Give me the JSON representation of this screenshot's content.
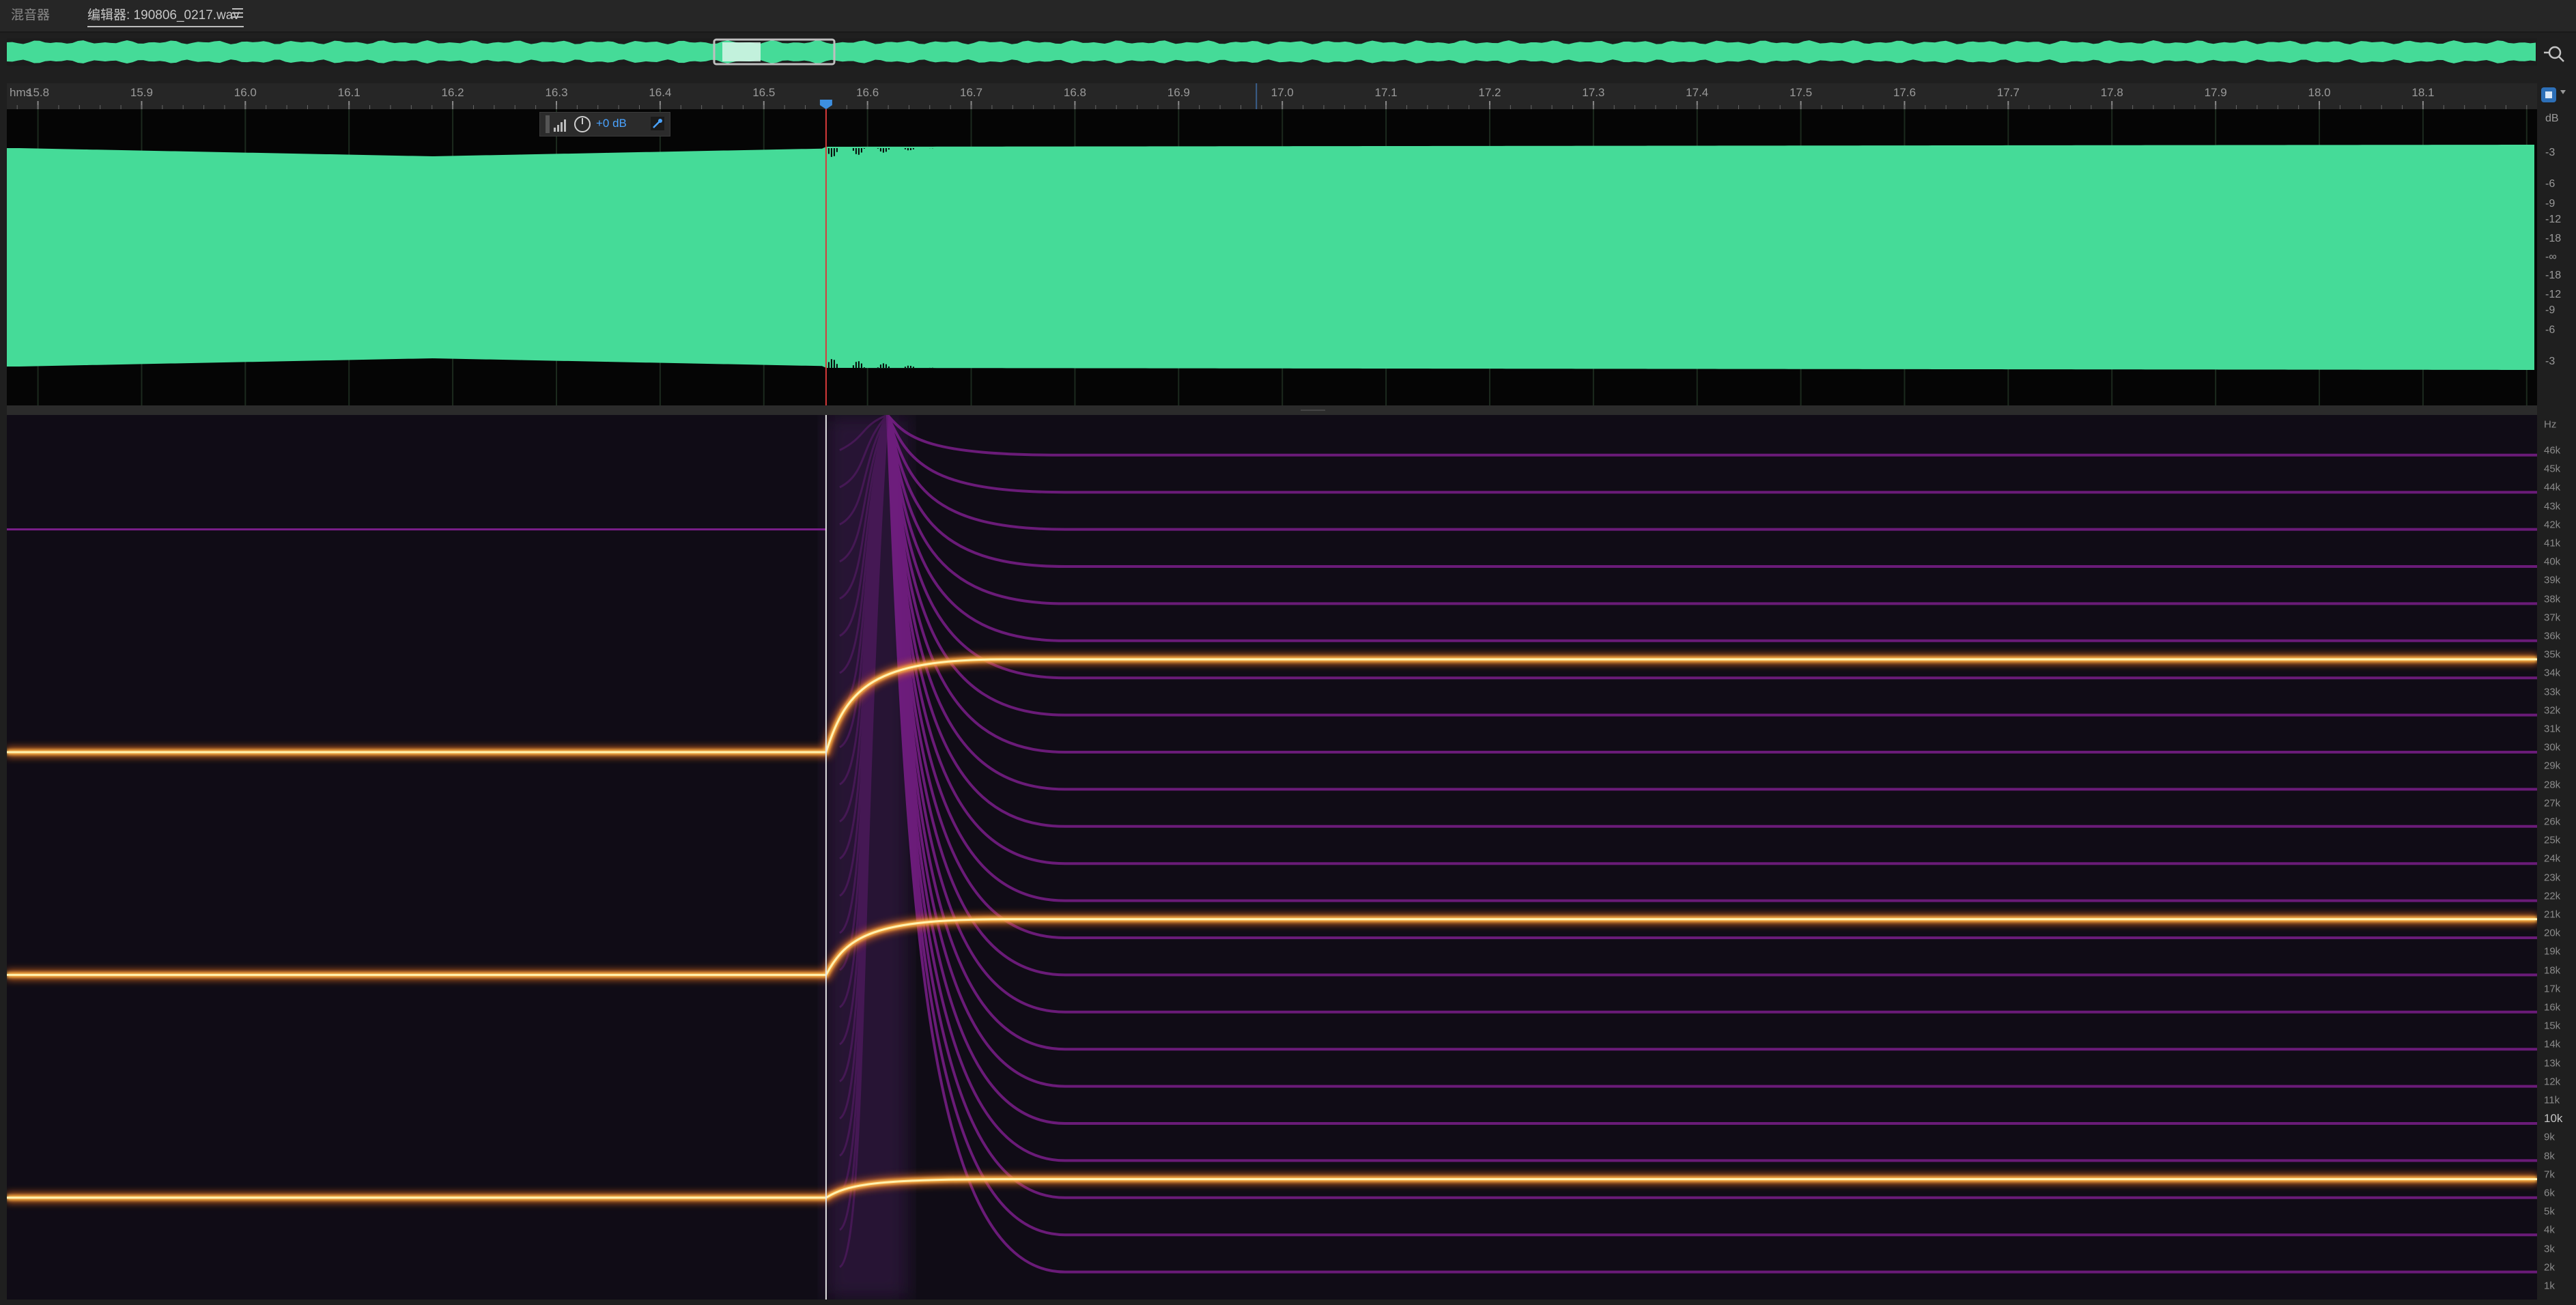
{
  "tabs": {
    "mixer": "混音器",
    "editor": "编辑器: 190806_0217.wav"
  },
  "ruler": {
    "unit": "hms",
    "range": [
      15.77,
      18.21
    ],
    "ticks": [
      "15.8",
      "15.9",
      "16.0",
      "16.1",
      "16.2",
      "16.3",
      "16.4",
      "16.5",
      "16.6",
      "16.7",
      "16.8",
      "16.9",
      "17.0",
      "17.1",
      "17.2",
      "17.3",
      "17.4",
      "17.5",
      "17.6",
      "17.7",
      "17.8",
      "17.9",
      "18.0",
      "18.1"
    ]
  },
  "playhead_time": 16.56,
  "hud": {
    "gain_label": "+0 dB"
  },
  "db_scale": {
    "unit": "dB",
    "labels": [
      "-3",
      "-6",
      "-9",
      "-12",
      "-18",
      "-∞",
      "-18",
      "-12",
      "-9",
      "-6",
      "-3"
    ]
  },
  "hz_scale": {
    "unit": "Hz",
    "labels": [
      "46k",
      "45k",
      "44k",
      "43k",
      "42k",
      "41k",
      "40k",
      "39k",
      "38k",
      "37k",
      "36k",
      "35k",
      "34k",
      "33k",
      "32k",
      "31k",
      "30k",
      "29k",
      "28k",
      "27k",
      "26k",
      "25k",
      "24k",
      "23k",
      "22k",
      "21k",
      "20k",
      "19k",
      "18k",
      "17k",
      "16k",
      "15k",
      "14k",
      "13k",
      "12k",
      "11k",
      "10k",
      "9k",
      "8k",
      "7k",
      "6k",
      "5k",
      "4k",
      "3k",
      "2k",
      "1k"
    ],
    "major": "10k"
  },
  "spectrogram": {
    "tones_before_hz": [
      29750,
      17750,
      5750
    ],
    "tones_after_hz": [
      34750,
      20750,
      6750
    ],
    "faint_line_before_hz": 41750
  },
  "colors": {
    "waveform": "#45db98",
    "background": "#1f1f1f",
    "playhead": "#d83a3a",
    "accent": "#4aa3ff"
  },
  "icons": {
    "tab_menu": "hamburger-icon",
    "zoom_settings": "zoom-settings-icon",
    "hud_level": "level-meter-icon",
    "hud_dial": "gain-dial-icon",
    "hud_pin": "pin-icon"
  }
}
